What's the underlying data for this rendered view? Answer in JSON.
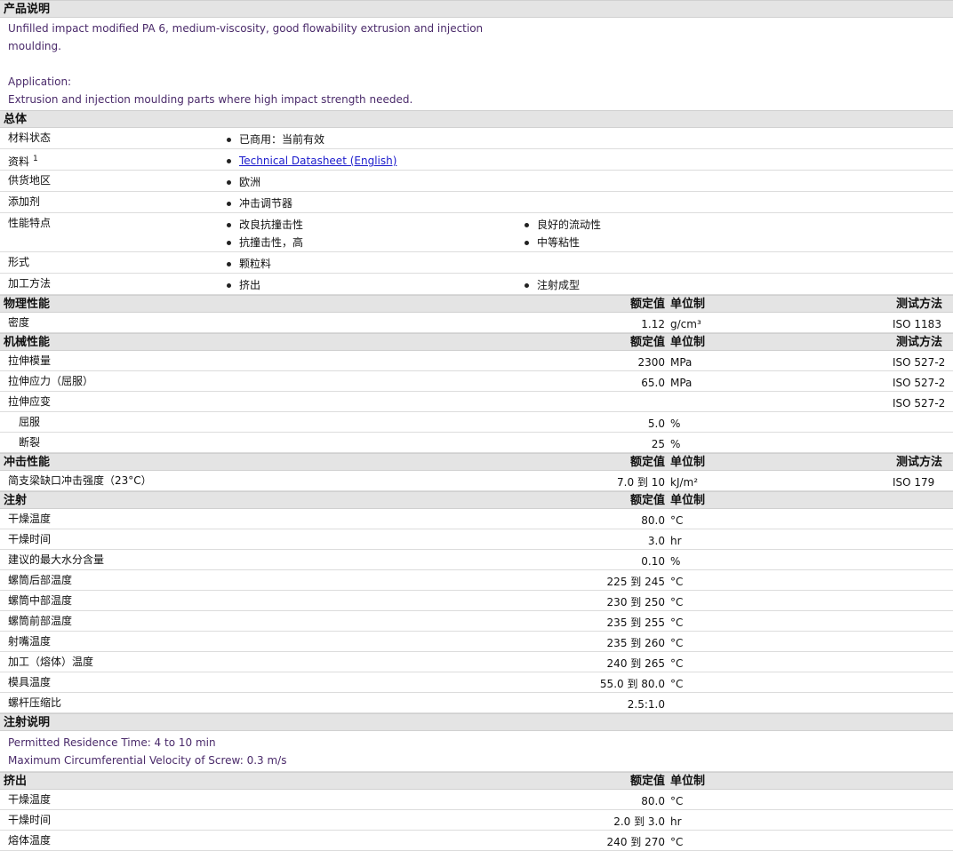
{
  "product_desc": {
    "title": "产品说明",
    "line1": "Unfilled impact modified PA 6, medium-viscosity, good flowability extrusion and injection",
    "line2": "moulding.",
    "app_label": "Application:",
    "app_text": "Extrusion and injection moulding parts where high impact strength needed."
  },
  "general": {
    "title": "总体",
    "rows": [
      {
        "label": "材料状态",
        "c1": [
          "已商用：当前有效"
        ],
        "c2": []
      },
      {
        "label": "资料",
        "sup": "1",
        "c1": [
          "Technical Datasheet (English)"
        ],
        "c2": [],
        "link": true
      },
      {
        "label": "供货地区",
        "c1": [
          "欧洲"
        ],
        "c2": []
      },
      {
        "label": "添加剂",
        "c1": [
          "冲击调节器"
        ],
        "c2": []
      },
      {
        "label": "性能特点",
        "c1": [
          "改良抗撞击性",
          "抗撞击性，高"
        ],
        "c2": [
          "良好的流动性",
          "中等粘性"
        ]
      },
      {
        "label": "形式",
        "c1": [
          "颗粒料"
        ],
        "c2": []
      },
      {
        "label": "加工方法",
        "c1": [
          "挤出"
        ],
        "c2": [
          "注射成型"
        ]
      }
    ]
  },
  "headers": {
    "value": "额定值",
    "unit": "单位制",
    "method": "测试方法"
  },
  "physical": {
    "title": "物理性能",
    "rows": [
      {
        "label": "密度",
        "value": "1.12",
        "unit": "g/cm³",
        "method": "ISO 1183"
      }
    ]
  },
  "mechanical": {
    "title": "机械性能",
    "rows": [
      {
        "label": "拉伸模量",
        "value": "2300",
        "unit": "MPa",
        "method": "ISO 527-2"
      },
      {
        "label": "拉伸应力（屈服）",
        "value": "65.0",
        "unit": "MPa",
        "method": "ISO 527-2"
      },
      {
        "label": "拉伸应变",
        "value": "",
        "unit": "",
        "method": "ISO 527-2"
      },
      {
        "label": "屈服",
        "value": "5.0",
        "unit": "%",
        "method": "",
        "indent": true
      },
      {
        "label": "断裂",
        "value": "25",
        "unit": "%",
        "method": "",
        "indent": true
      }
    ]
  },
  "impact": {
    "title": "冲击性能",
    "rows": [
      {
        "label": "简支梁缺口冲击强度（23°C）",
        "value": "7.0 到  10",
        "unit": "kJ/m²",
        "method": "ISO 179"
      }
    ]
  },
  "injection": {
    "title": "注射",
    "rows": [
      {
        "label": "干燥温度",
        "value": "80.0",
        "unit": "°C"
      },
      {
        "label": "干燥时间",
        "value": "3.0",
        "unit": "hr"
      },
      {
        "label": "建议的最大水分含量",
        "value": "0.10",
        "unit": "%"
      },
      {
        "label": "螺筒后部温度",
        "value": "225 到  245",
        "unit": "°C"
      },
      {
        "label": "螺筒中部温度",
        "value": "230 到  250",
        "unit": "°C"
      },
      {
        "label": "螺筒前部温度",
        "value": "235 到  255",
        "unit": "°C"
      },
      {
        "label": "射嘴温度",
        "value": "235 到  260",
        "unit": "°C"
      },
      {
        "label": "加工（熔体）温度",
        "value": "240 到  265",
        "unit": "°C"
      },
      {
        "label": "模具温度",
        "value": "55.0 到  80.0",
        "unit": "°C"
      },
      {
        "label": "螺杆压缩比",
        "value": "2.5:1.0",
        "unit": ""
      }
    ]
  },
  "injection_notes": {
    "title": "注射说明",
    "line1": "Permitted Residence Time: 4 to 10 min",
    "line2": "Maximum Circumferential Velocity of Screw: 0.3 m/s"
  },
  "extrusion": {
    "title": "挤出",
    "rows": [
      {
        "label": "干燥温度",
        "value": "80.0",
        "unit": "°C"
      },
      {
        "label": "干燥时间",
        "value": "2.0 到  3.0",
        "unit": "hr"
      },
      {
        "label": "熔体温度",
        "value": "240 到  270",
        "unit": "°C"
      }
    ]
  }
}
